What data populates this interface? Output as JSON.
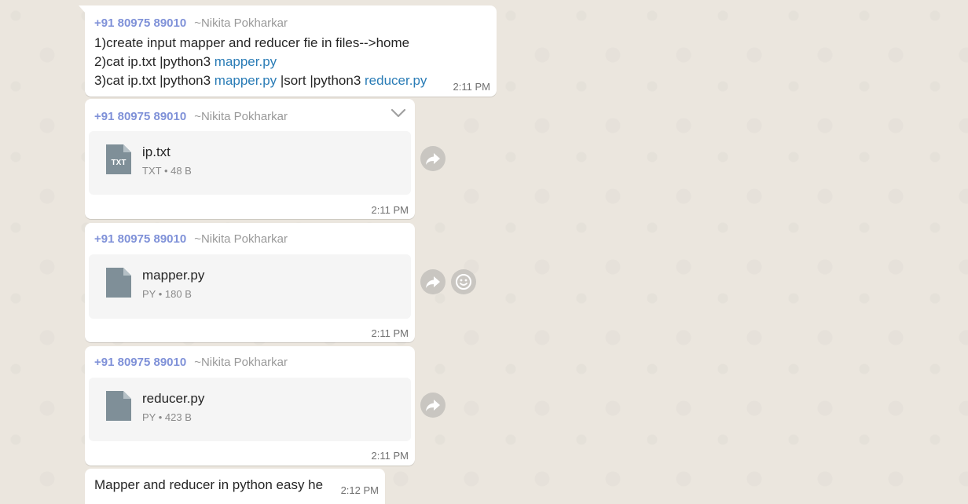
{
  "messages": [
    {
      "phone": "+91 80975 89010",
      "nick": "~Nikita Pokharkar",
      "line1": "1)create input mapper and reducer fie in files-->home",
      "line2_pre": "2)cat ip.txt |python3 ",
      "line2_link": "mapper.py",
      "line3_pre": "3)cat ip.txt |python3 ",
      "line3_link1": "mapper.py",
      "line3_mid": " |sort |python3 ",
      "line3_link2": "reducer.py",
      "time": "2:11 PM"
    },
    {
      "phone": "+91 80975 89010",
      "nick": "~Nikita Pokharkar",
      "file_name": "ip.txt",
      "file_type": "TXT",
      "file_size": "48 B",
      "icon_label": "TXT",
      "time": "2:11 PM",
      "icon": "txt-file-icon"
    },
    {
      "phone": "+91 80975 89010",
      "nick": "~Nikita Pokharkar",
      "file_name": "mapper.py",
      "file_type": "PY",
      "file_size": "180 B",
      "time": "2:11 PM",
      "icon": "generic-file-icon"
    },
    {
      "phone": "+91 80975 89010",
      "nick": "~Nikita Pokharkar",
      "file_name": "reducer.py",
      "file_type": "PY",
      "file_size": "423 B",
      "time": "2:11 PM",
      "icon": "generic-file-icon"
    },
    {
      "text": "Mapper and reducer in python easy he",
      "time": "2:12 PM"
    }
  ],
  "meta_separator": " • ",
  "icons": {
    "forward": "forward-icon",
    "emoji": "emoji-icon",
    "menu": "chevron-down-icon"
  },
  "colors": {
    "phone": "#7f91d8",
    "nick": "#999999",
    "link": "#2a7cb6",
    "bubble": "#ffffff",
    "file_card": "#f5f5f5",
    "file_icon": "#7f8f98",
    "background": "#ebe6de"
  }
}
